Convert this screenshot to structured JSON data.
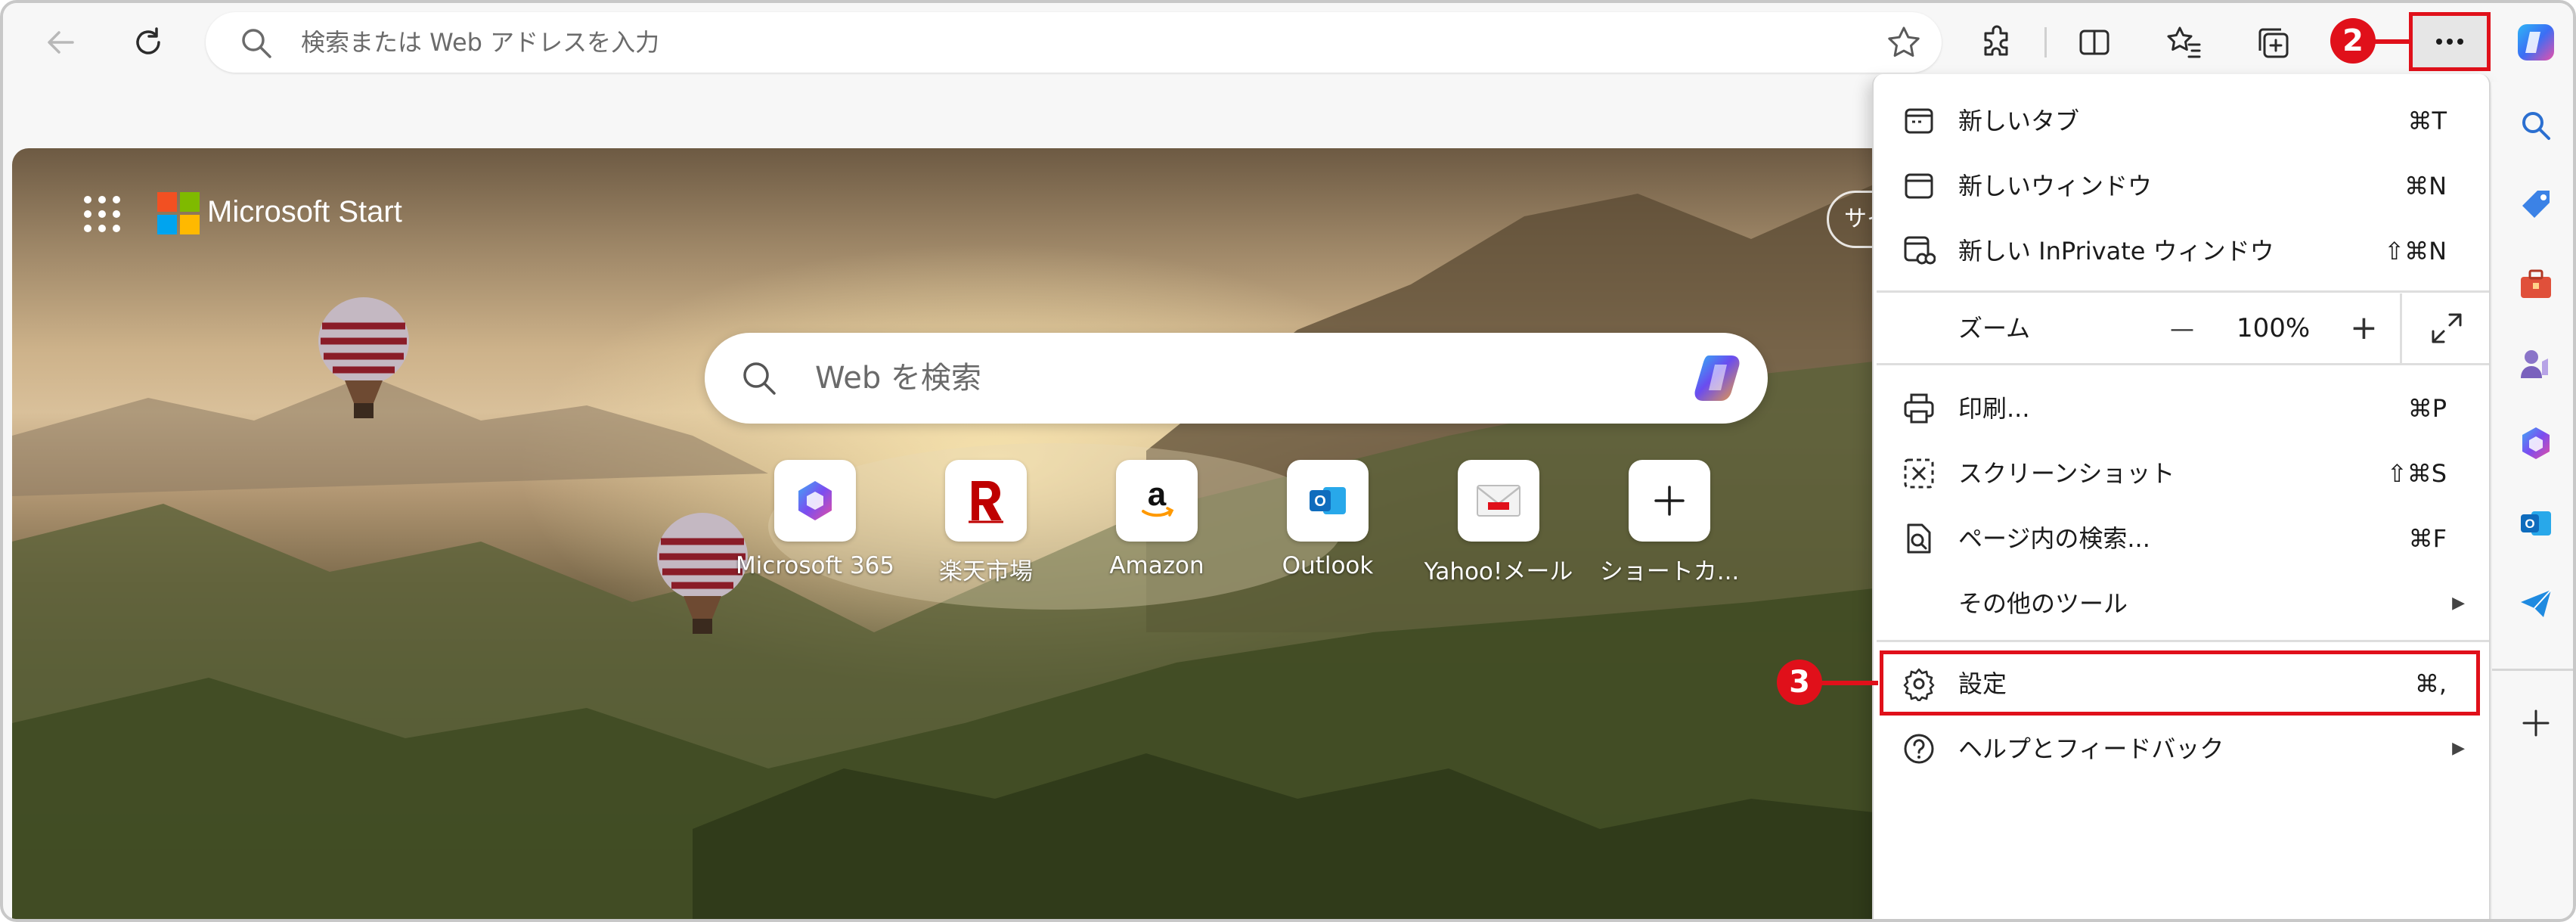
{
  "toolbar": {
    "address_placeholder": "検索または Web アドレスを入力"
  },
  "callouts": {
    "step2": "2",
    "step3": "3"
  },
  "newtab": {
    "brand": "Microsoft Start",
    "search_placeholder": "Web を検索",
    "signin_chip": "サイ",
    "tiles": [
      {
        "label": "Microsoft 365",
        "icon": "microsoft-365-icon"
      },
      {
        "label": "楽天市場",
        "icon": "rakuten-icon"
      },
      {
        "label": "Amazon",
        "icon": "amazon-icon"
      },
      {
        "label": "Outlook",
        "icon": "outlook-icon"
      },
      {
        "label": "Yahoo!メール",
        "icon": "yahoo-mail-icon"
      },
      {
        "label": "ショートカ...",
        "icon": "add-shortcut-icon"
      }
    ]
  },
  "menu": {
    "new_tab": {
      "label": "新しいタブ",
      "shortcut": "⌘T"
    },
    "new_window": {
      "label": "新しいウィンドウ",
      "shortcut": "⌘N"
    },
    "new_inprivate": {
      "label": "新しい InPrivate ウィンドウ",
      "shortcut": "⇧⌘N"
    },
    "zoom": {
      "label": "ズーム",
      "value": "100%",
      "minus": "—",
      "plus": "+"
    },
    "print": {
      "label": "印刷...",
      "shortcut": "⌘P"
    },
    "screenshot": {
      "label": "スクリーンショット",
      "shortcut": "⇧⌘S"
    },
    "find": {
      "label": "ページ内の検索...",
      "shortcut": "⌘F"
    },
    "more_tools": {
      "label": "その他のツール"
    },
    "settings": {
      "label": "設定",
      "shortcut": "⌘,"
    },
    "help": {
      "label": "ヘルプとフィードバック"
    }
  },
  "colors": {
    "highlight": "#e0101a",
    "page_bg_top": "#6d5a43",
    "page_bg_bottom": "#333c20"
  }
}
